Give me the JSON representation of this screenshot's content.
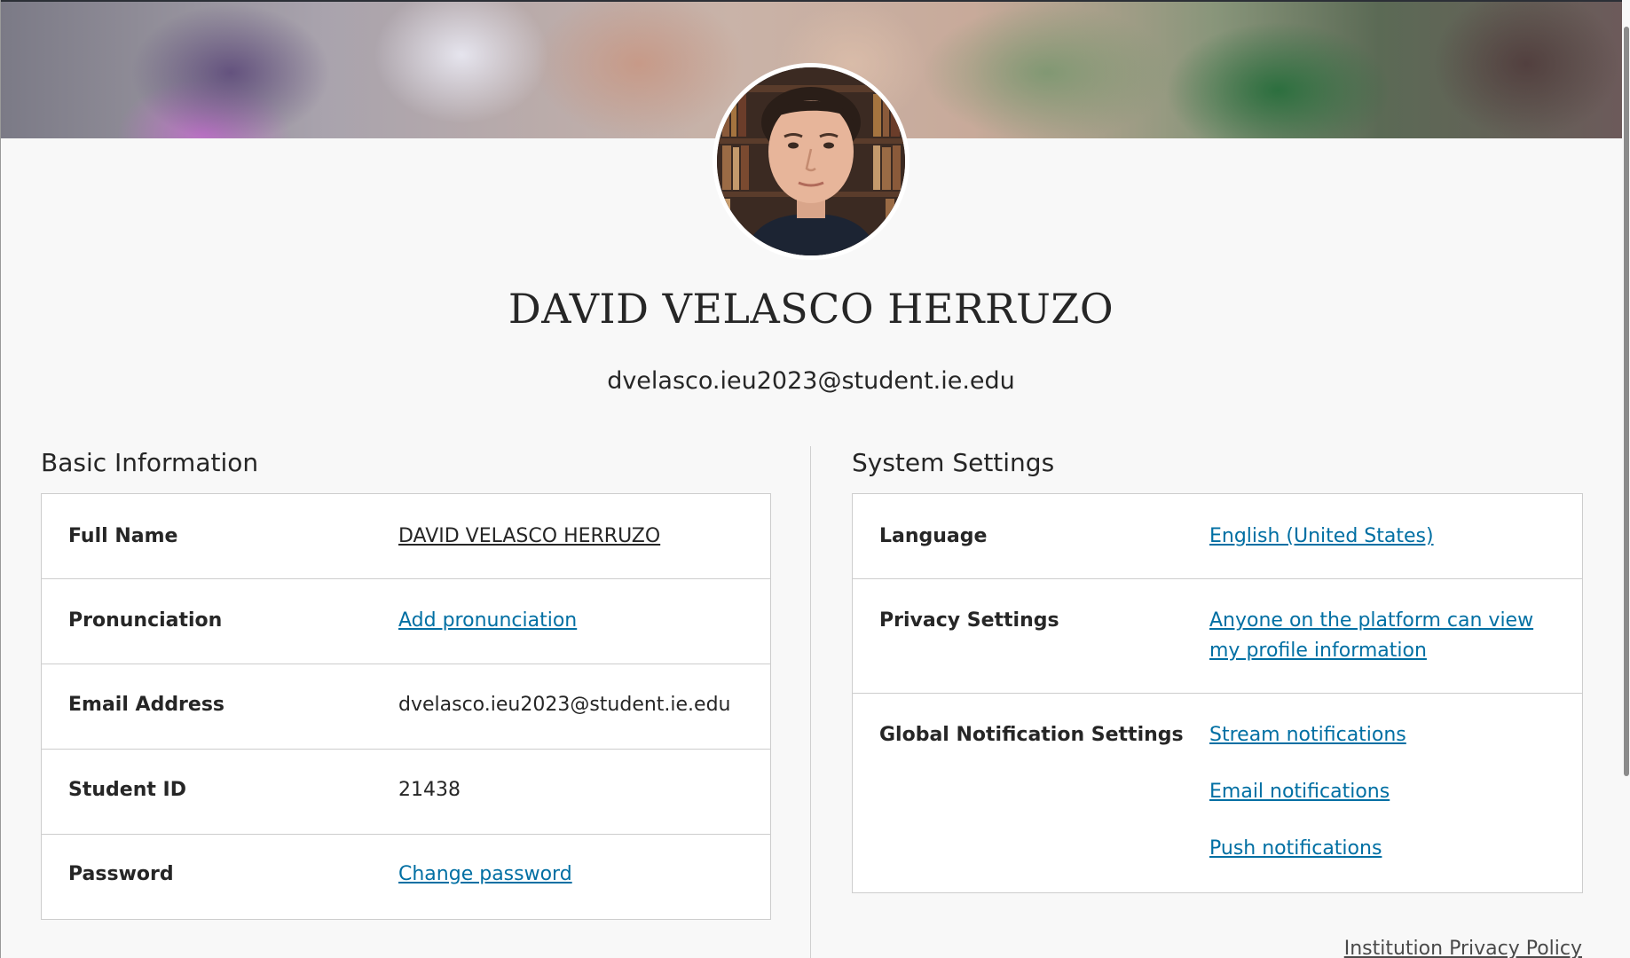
{
  "profile": {
    "name": "DAVID VELASCO HERRUZO",
    "email": "dvelasco.ieu2023@student.ie.edu"
  },
  "basic_information": {
    "title": "Basic Information",
    "rows": [
      {
        "label": "Full Name",
        "value": "DAVID VELASCO HERRUZO"
      },
      {
        "label": "Pronunciation",
        "value": "Add pronunciation"
      },
      {
        "label": "Email Address",
        "value": "dvelasco.ieu2023@student.ie.edu"
      },
      {
        "label": "Student ID",
        "value": "21438"
      },
      {
        "label": "Password",
        "value": "Change password"
      }
    ]
  },
  "system_settings": {
    "title": "System Settings",
    "language": {
      "label": "Language",
      "value": "English (United States)"
    },
    "privacy": {
      "label": "Privacy Settings",
      "value_line1": "Anyone on the platform can view",
      "value_line2": "my profile information"
    },
    "notifications": {
      "label": "Global Notification Settings",
      "links": [
        "Stream notifications",
        "Email notifications",
        "Push notifications"
      ]
    }
  },
  "footer": {
    "privacy_policy": "Institution Privacy Policy"
  },
  "colors": {
    "link": "#006fa3",
    "text": "#262626",
    "background": "#f8f8f8",
    "card": "#ffffff"
  }
}
